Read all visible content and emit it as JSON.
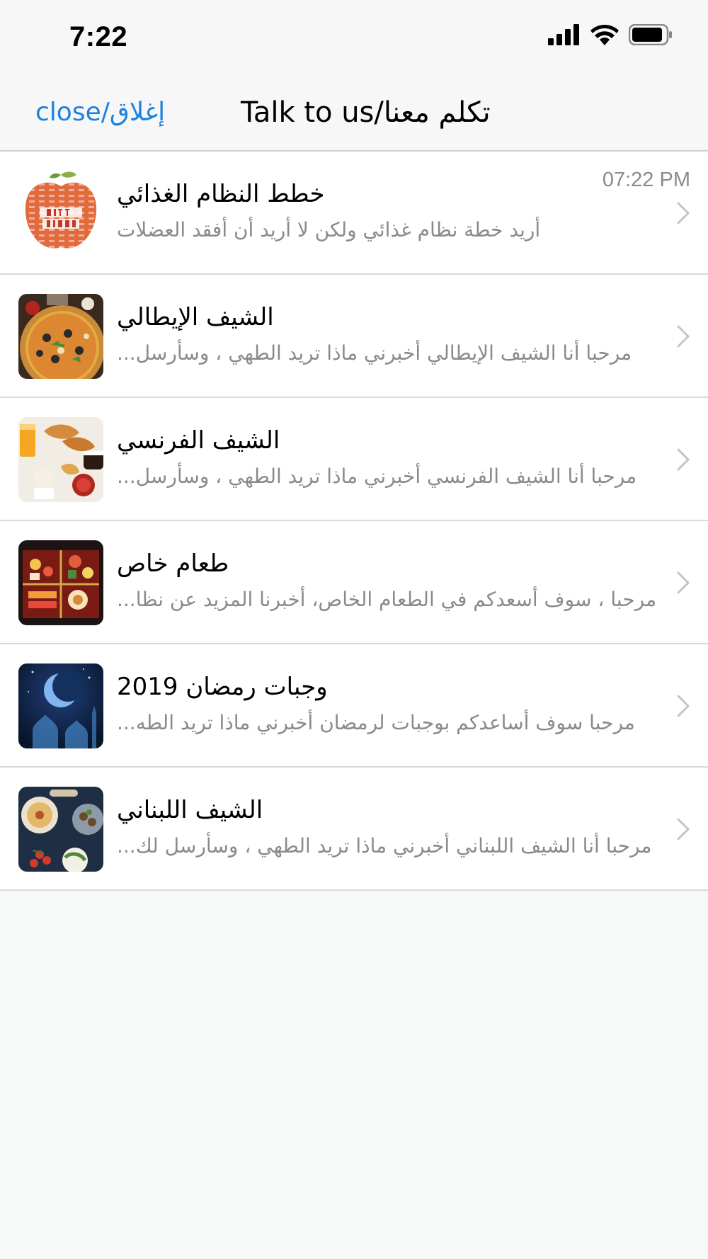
{
  "status_bar": {
    "time": "7:22"
  },
  "nav": {
    "close_label": "close/إغلاق",
    "title": "Talk to us/تكلم معنا"
  },
  "conversations": [
    {
      "title": "خطط النظام الغذائي",
      "subtitle": "أريد خطة نظام غذائي ولكن لا أريد أن أفقد العضلات",
      "time": "07:22 PM",
      "image": "diet-plan-apple-image"
    },
    {
      "title": "الشيف الإيطالي",
      "subtitle": "مرحبا أنا الشيف الإيطالي أخبرني ماذا تريد الطهي ، وسأرسل...",
      "time": "",
      "image": "pizza-image"
    },
    {
      "title": "الشيف الفرنسي",
      "subtitle": "مرحبا أنا الشيف الفرنسي أخبرني ماذا تريد الطهي ، وسأرسل...",
      "time": "",
      "image": "breakfast-image"
    },
    {
      "title": "طعام خاص",
      "subtitle": "مرحبا ، سوف أسعدكم في الطعام الخاص، أخبرنا المزيد عن نظا...",
      "time": "",
      "image": "bento-box-image"
    },
    {
      "title": "وجبات رمضان 2019",
      "subtitle": "مرحبا سوف أساعدكم بوجبات لرمضان أخبرني ماذا تريد الطه...",
      "time": "",
      "image": "ramadan-moon-image"
    },
    {
      "title": "الشيف اللبناني",
      "subtitle": "مرحبا أنا الشيف اللبناني أخبرني ماذا تريد الطهي ، وسأرسل لك...",
      "time": "",
      "image": "lebanese-mezze-image"
    }
  ],
  "colors": {
    "accent": "#1a82e0",
    "background": "#f7f8f8",
    "row_background": "#ffffff",
    "secondary_text": "#8a8a8a"
  }
}
